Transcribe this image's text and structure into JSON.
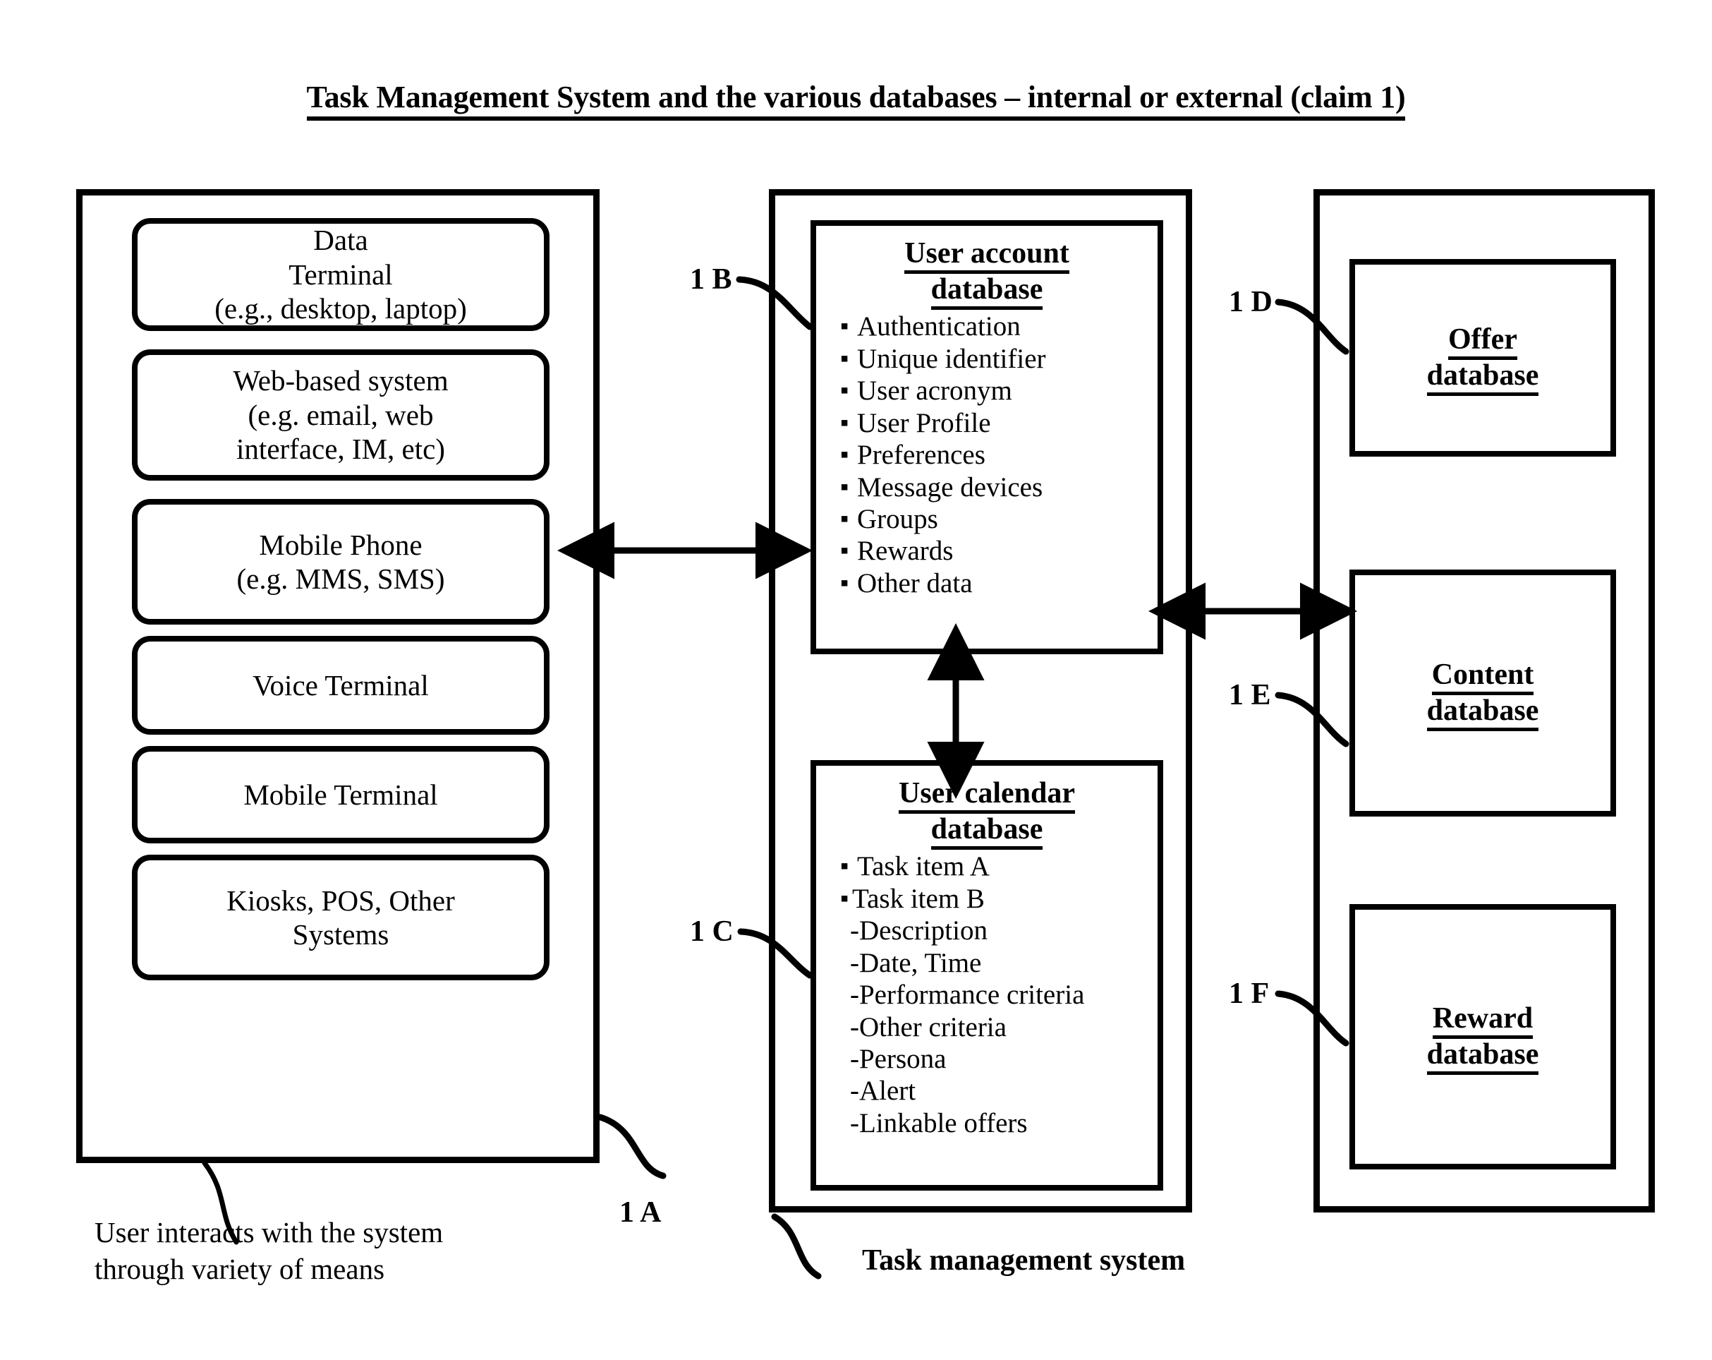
{
  "figure": {
    "title": "Task Management System and the various databases – internal or external (claim 1)"
  },
  "devices_panel": {
    "ref_label": "1 A",
    "caption": "User interacts with the system\nthrough variety of means",
    "items": [
      {
        "id": "data-terminal",
        "lines": [
          "Data",
          "Terminal",
          "(e.g., desktop, laptop)"
        ]
      },
      {
        "id": "web-based",
        "lines": [
          "Web-based system",
          "(e.g. email, web",
          "interface, IM, etc)"
        ]
      },
      {
        "id": "mobile-phone",
        "lines": [
          "Mobile Phone",
          "(e.g. MMS, SMS)"
        ]
      },
      {
        "id": "voice-terminal",
        "lines": [
          "Voice Terminal"
        ]
      },
      {
        "id": "mobile-terminal",
        "lines": [
          "Mobile Terminal"
        ]
      },
      {
        "id": "kiosks",
        "lines": [
          "Kiosks, POS, Other",
          "Systems"
        ]
      }
    ]
  },
  "tms_panel": {
    "caption": "Task management system",
    "user_account_db": {
      "ref_label": "1 B",
      "title_line1": "User account",
      "title_line2": "database",
      "items": [
        "Authentication",
        "Unique identifier",
        "User acronym",
        "User Profile",
        "Preferences",
        "Message devices",
        "Groups",
        "Rewards",
        "Other data"
      ]
    },
    "user_calendar_db": {
      "ref_label": "1 C",
      "title_line1": "User calendar",
      "title_line2": "database",
      "bullet_items": [
        "Task item A",
        "Task item B"
      ],
      "dash_items": [
        "-Description",
        "-Date, Time",
        "-Performance criteria",
        "-Other criteria",
        "-Persona",
        "-Alert",
        "-Linkable offers"
      ]
    }
  },
  "databases_panel": {
    "items": [
      {
        "id": "offer-database",
        "ref_label": "1 D",
        "title_line1": "Offer",
        "title_line2": "database"
      },
      {
        "id": "content-database",
        "ref_label": "1 E",
        "title_line1": "Content",
        "title_line2": "database"
      },
      {
        "id": "reward-database",
        "ref_label": "1 F",
        "title_line1": "Reward",
        "title_line2": "database"
      }
    ]
  },
  "connectors": [
    {
      "id": "devices-to-tms",
      "kind": "double-arrow-horizontal"
    },
    {
      "id": "tms-to-databases",
      "kind": "double-arrow-horizontal"
    },
    {
      "id": "account-to-calendar",
      "kind": "double-arrow-vertical"
    }
  ],
  "colors": {
    "ink": "#000000",
    "background": "#ffffff"
  }
}
